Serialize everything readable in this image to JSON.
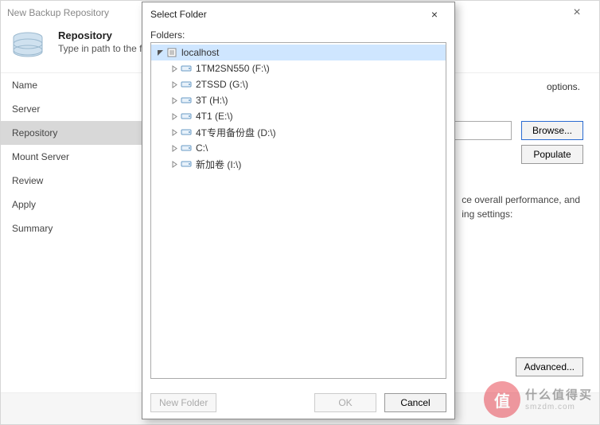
{
  "wizard": {
    "title": "New Backup Repository",
    "close_glyph": "×",
    "header_title": "Repository",
    "header_sub": "Type in path to the f",
    "header_sub_right": "options.",
    "hint_line1": "ce overall performance, and",
    "hint_line2": "ing settings:",
    "browse_label": "Browse...",
    "populate_label": "Populate",
    "advanced_label": "Advanced..."
  },
  "sidebar": {
    "items": [
      {
        "label": "Name",
        "active": false
      },
      {
        "label": "Server",
        "active": false
      },
      {
        "label": "Repository",
        "active": true
      },
      {
        "label": "Mount Server",
        "active": false
      },
      {
        "label": "Review",
        "active": false
      },
      {
        "label": "Apply",
        "active": false
      },
      {
        "label": "Summary",
        "active": false
      }
    ]
  },
  "modal": {
    "title": "Select Folder",
    "close_glyph": "×",
    "folders_label": "Folders:",
    "newfolder_label": "New Folder",
    "ok_label": "OK",
    "cancel_label": "Cancel",
    "tree": {
      "root": {
        "label": "localhost",
        "expanded": true,
        "selected": true,
        "icon": "server"
      },
      "children": [
        {
          "label": "1TM2SN550 (F:\\)",
          "icon": "drive"
        },
        {
          "label": "2TSSD (G:\\)",
          "icon": "drive"
        },
        {
          "label": "3T (H:\\)",
          "icon": "drive"
        },
        {
          "label": "4T1 (E:\\)",
          "icon": "drive"
        },
        {
          "label": "4T专用备份盘 (D:\\)",
          "icon": "drive"
        },
        {
          "label": "C:\\",
          "icon": "drive"
        },
        {
          "label": "新加卷 (I:\\)",
          "icon": "drive"
        }
      ]
    }
  },
  "watermark": {
    "badge": "值",
    "line1": "什么值得买",
    "line2": "smzdm.com"
  }
}
